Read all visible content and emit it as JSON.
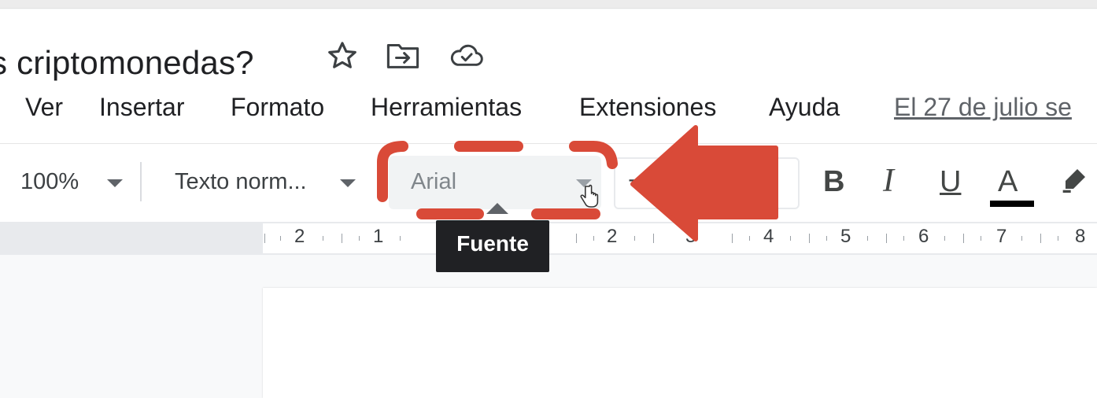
{
  "document": {
    "title": "s criptomonedas?",
    "icons": [
      "star-icon",
      "move-to-folder-icon",
      "cloud-saved-icon"
    ]
  },
  "menu": {
    "items": [
      {
        "label": "Ver"
      },
      {
        "label": "Insertar"
      },
      {
        "label": "Formato"
      },
      {
        "label": "Herramientas"
      },
      {
        "label": "Extensiones"
      },
      {
        "label": "Ayuda"
      }
    ],
    "notice": "El 27 de julio se"
  },
  "toolbar": {
    "zoom": "100%",
    "style": "Texto norm...",
    "font": "Arial",
    "font_size_minus": "−",
    "bold": "B",
    "italic": "I",
    "underline": "U",
    "text_color": "A",
    "text_color_value": "#000000",
    "icons": [
      "chevron-down-icon",
      "highlighter-icon"
    ]
  },
  "tooltip": {
    "label": "Fuente"
  },
  "ruler": {
    "labels": [
      "2",
      "1",
      "2",
      "3",
      "4",
      "5",
      "6",
      "7",
      "8"
    ]
  },
  "annotation": {
    "color": "#d94a38"
  }
}
